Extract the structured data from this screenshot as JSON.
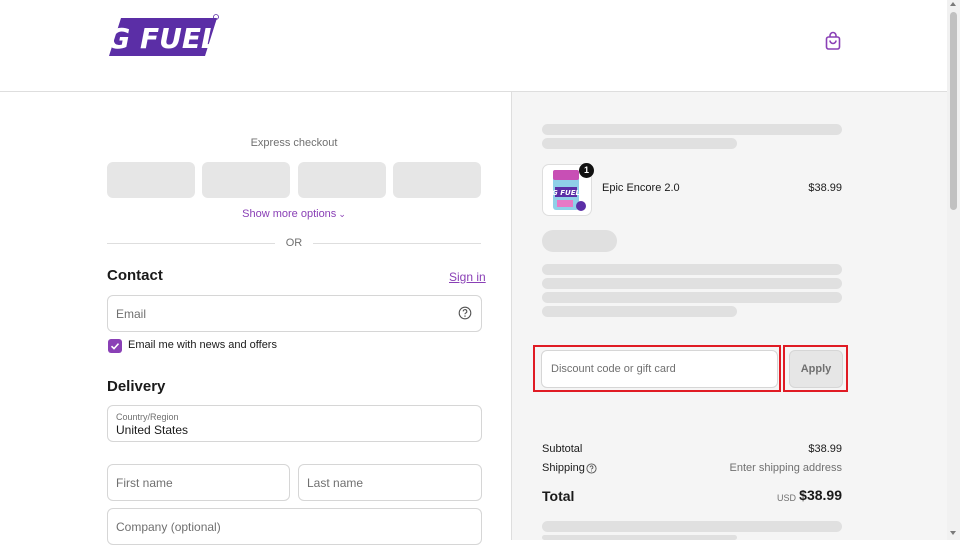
{
  "header": {
    "logo_text": "G FUEL",
    "cart_icon": "shopping-bag-icon"
  },
  "colors": {
    "brand": "#8a40b6",
    "logo_purple": "#5b2ea6",
    "highlight": "#e01b24",
    "skeleton": "#e0e0e0"
  },
  "express": {
    "title": "Express checkout",
    "show_more": "Show more options",
    "divider": "OR"
  },
  "contact": {
    "heading": "Contact",
    "sign_in": "Sign in",
    "email_placeholder": "Email",
    "newsletter_label": "Email me with news and offers",
    "newsletter_checked": true
  },
  "delivery": {
    "heading": "Delivery",
    "country_label": "Country/Region",
    "country_value": "United States",
    "first_name_placeholder": "First name",
    "last_name_placeholder": "Last name",
    "company_placeholder": "Company (optional)"
  },
  "order": {
    "item": {
      "name": "Epic Encore 2.0",
      "price": "$38.99",
      "quantity": "1",
      "thumb_text": "G FUEL"
    },
    "discount_placeholder": "Discount code or gift card",
    "apply_label": "Apply",
    "subtotal_label": "Subtotal",
    "subtotal_value": "$38.99",
    "shipping_label": "Shipping",
    "shipping_value": "Enter shipping address",
    "total_label": "Total",
    "total_currency": "USD",
    "total_value": "$38.99"
  }
}
